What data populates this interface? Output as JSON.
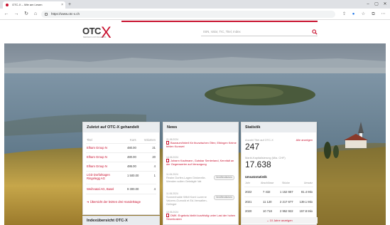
{
  "browser": {
    "tab_title": "OTC-X – Wie am Lesen",
    "url": "https://www.otc-x.ch"
  },
  "site": {
    "logo_text": "OTC",
    "logo_mark": "X",
    "logo_sub": "BERNER KANTONALBANK",
    "search_placeholder": "ISIN, Valor, TIC, Titel, Index"
  },
  "last_traded": {
    "title": "Zuletzt auf OTC-X gehandelt",
    "headers": [
      "Titel",
      "Kurs",
      "Volumen"
    ],
    "rows": [
      {
        "title": "Elham Group N",
        "price": "480.00",
        "volume": "21"
      },
      {
        "title": "Elham Group N",
        "price": "480.00",
        "volume": "20"
      },
      {
        "title": "Elham Group N",
        "price": "486.00",
        "volume": "4"
      },
      {
        "title": "LGD Dorfahtagen Ringelegg AG",
        "price": "1 500.00",
        "volume": "1"
      },
      {
        "title": "Weihnatal AG, Basel",
        "price": "9 300.00",
        "volume": "4"
      }
    ],
    "more": "Übersicht der letzten drei Handelstage",
    "next_title": "Indexübersicht OTC-X"
  },
  "news": {
    "title": "News",
    "items": [
      {
        "date": "21.06.2024",
        "text": "Bauraum/Interil für thurwischen Öfen; Elbingen Keime fehlen Kurzwei",
        "badge": "",
        "active": true
      },
      {
        "date": "14.06.2024",
        "text": "Johann Kaufmann, Gutsbar Senterland, Kennfalt an der Gegenwerter auf Versorgung",
        "badge": "",
        "active": true
      },
      {
        "date": "11.06.2024",
        "text": "Realm Dorfen-Lagen Dinkerelle-Wenden sollen Gekrägtir Vat",
        "badge": "Veröffentlichen",
        "active": false
      },
      {
        "date": "11.06.2024",
        "text": "Sonnenhalde Wildt Kant Luzerne Valoren-Gumold et Ed-Verwalten-Gelinger",
        "badge": "Veröffentlichen",
        "active": false
      },
      {
        "date": "10.06.2024",
        "text": "DMK: Ergebnis bleibt kurzfristig unter Last der hohen Stromkosten",
        "badge": "",
        "active": true
      }
    ]
  },
  "stats": {
    "title": "Statistik",
    "count_label": "Anzahl Titel auf OTC-X",
    "count_link": "Alle anzeigen",
    "count": "247",
    "cap_label": "Markt-Kapitalisierung (Mia. CHF)",
    "cap": "17.638",
    "turnover_title": "Umsatzstatistik",
    "headers": [
      "Jahr",
      "Abschlüsse",
      "Stücke",
      "Umsatz"
    ],
    "rows": [
      {
        "year": "2022",
        "trades": "7 432",
        "pieces": "1 152 657",
        "turnover": "81.4 Mio"
      },
      {
        "year": "2021",
        "trades": "11 120",
        "pieces": "2 217 677",
        "turnover": "139.1 Mio"
      },
      {
        "year": "2020",
        "trades": "10 718",
        "pieces": "2 952 922",
        "turnover": "157.8 Mio"
      }
    ],
    "more": "10 Jahre anzeigen"
  },
  "colors": {
    "accent": "#c8102e"
  }
}
